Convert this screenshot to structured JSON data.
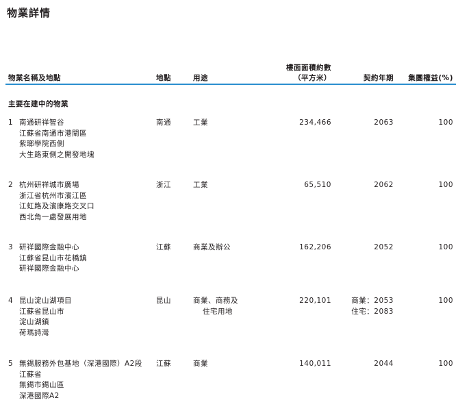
{
  "page_title": "物業詳情",
  "headers": {
    "name_location": "物業名稱及地點",
    "location": "地點",
    "use": "用途",
    "gfa_line1": "樓面面積約數",
    "gfa_line2": "（平方米）",
    "lease_expiry": "契約年期",
    "group_interest": "集團權益(%)"
  },
  "section_label": "主要在建中的物業",
  "rows": [
    {
      "no": "1",
      "name_lines": [
        "南通研祥智谷",
        "江蘇省南通市港閘區",
        "紫瑯學院西側",
        "大生路東側之開發地塊"
      ],
      "location": "南通",
      "use_lines": [
        "工業"
      ],
      "area": "234,466",
      "lease_lines": [
        "2063"
      ],
      "interest": "100"
    },
    {
      "no": "2",
      "name_lines": [
        "杭州研祥城市廣場",
        "浙江省杭州市濱江區",
        "江虹路及濱康路交叉口",
        "西北角一處發展用地"
      ],
      "location": "浙江",
      "use_lines": [
        "工業"
      ],
      "area": "65,510",
      "lease_lines": [
        "2062"
      ],
      "interest": "100"
    },
    {
      "no": "3",
      "name_lines": [
        "研祥國際金融中心",
        "江蘇省昆山市花橋鎮",
        "研祥國際金融中心"
      ],
      "location": "江蘇",
      "use_lines": [
        "商業及辦公"
      ],
      "area": "162,206",
      "lease_lines": [
        "2052"
      ],
      "interest": "100"
    },
    {
      "no": "4",
      "name_lines": [
        "昆山淀山湖項目",
        "江蘇省昆山市",
        "淀山湖鎮",
        "荷瑪詩灣"
      ],
      "location": "昆山",
      "use_lines": [
        "商業、商務及",
        "住宅用地"
      ],
      "area": "220,101",
      "lease_lines": [
        "商業：2053",
        "住宅：2083"
      ],
      "interest": "100"
    },
    {
      "no": "5",
      "name_lines": [
        "無錫服務外包基地（深港國際）A2段",
        "江蘇省",
        "無錫市錫山區",
        "深港國際A2"
      ],
      "location": "江蘇",
      "use_lines": [
        "商業"
      ],
      "area": "140,011",
      "lease_lines": [
        "2044"
      ],
      "interest": "100"
    }
  ]
}
